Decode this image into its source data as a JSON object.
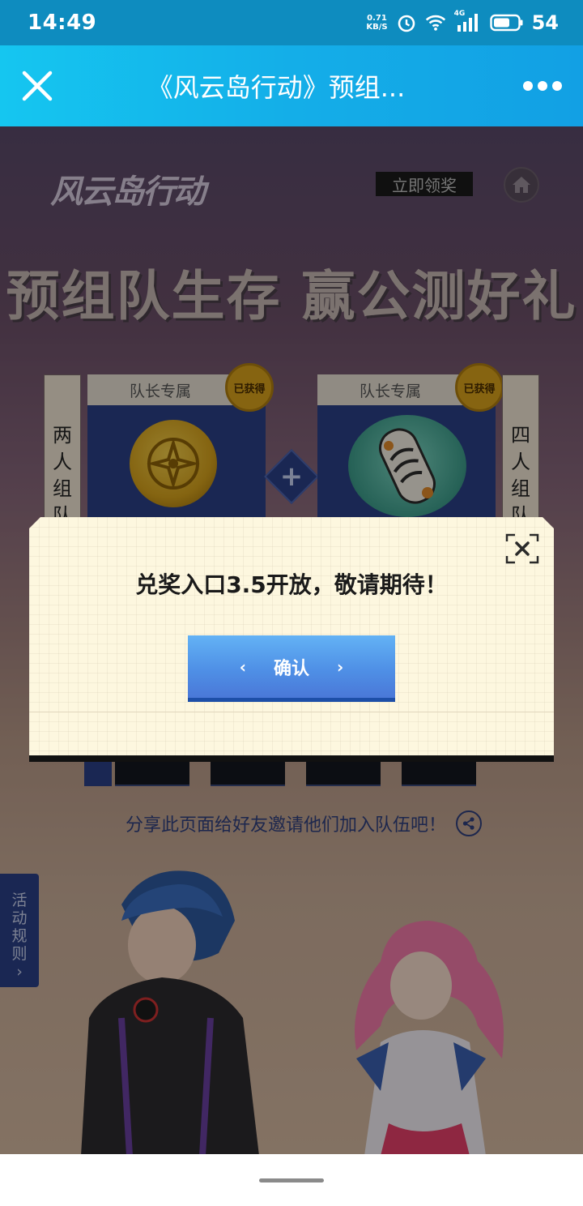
{
  "status_bar": {
    "time": "14:49",
    "net_speed_value": "0.71",
    "net_speed_unit": "KB/S",
    "network_type": "4G",
    "battery": "54"
  },
  "title_bar": {
    "title": "《风云岛行动》预组..."
  },
  "page": {
    "logo": "风云岛行动",
    "claim_button": "立即领奖",
    "headline": "预组队生存  赢公测好礼",
    "left_label_chars": [
      "两",
      "人",
      "组",
      "队"
    ],
    "right_label_chars": [
      "四",
      "人",
      "组",
      "队"
    ],
    "reward_cards": [
      {
        "header": "队长专属",
        "badge": "已获得"
      },
      {
        "header": "队长专属",
        "badge": "已获得"
      }
    ],
    "share_text": "分享此页面给好友邀请他们加入队伍吧！",
    "rules_tab_chars": [
      "活",
      "动",
      "规",
      "则",
      "›"
    ]
  },
  "modal": {
    "message": "兑奖入口3.5开放，敬请期待！",
    "confirm_label": "确认",
    "chevron_left": "‹",
    "chevron_right": "›"
  },
  "colors": {
    "title_bar": "#14aee8",
    "status_bar": "#0e8cbf",
    "modal_bg": "#fdf7df",
    "confirm_button": "#4f90e6"
  }
}
